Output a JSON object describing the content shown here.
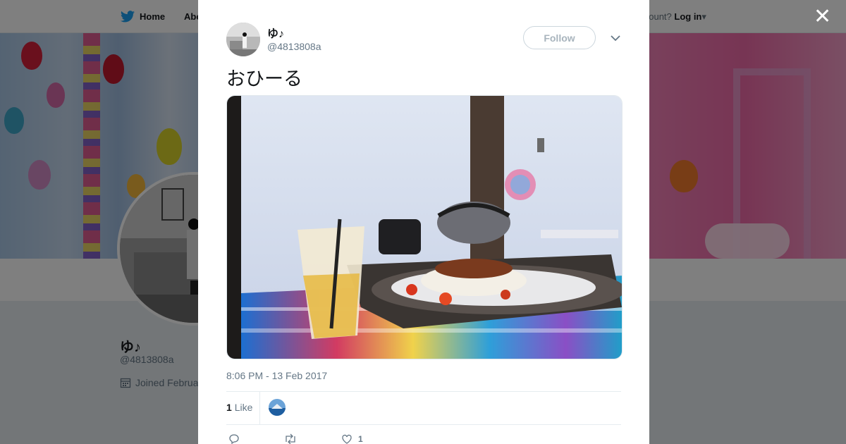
{
  "topnav": {
    "home_label": "Home",
    "about_label": "About",
    "have_account_text": "account?",
    "login_label": "Log in"
  },
  "profile": {
    "name": "ゆ♪",
    "handle": "@4813808a",
    "joined_text": "Joined February"
  },
  "tweet": {
    "author_name": "ゆ♪",
    "author_handle": "@4813808a",
    "follow_label": "Follow",
    "text": "おひーる",
    "timestamp": "8:06 PM - 13 Feb 2017",
    "like_count": "1",
    "like_word": "Like",
    "action_like_count": "1"
  },
  "colors": {
    "twitter_blue": "#1da1f2",
    "text_primary": "#14171a",
    "text_secondary": "#657786"
  },
  "icons": [
    "twitter-bird-icon",
    "calendar-icon",
    "close-icon",
    "chevron-down-icon",
    "reply-icon",
    "retweet-icon",
    "heart-icon"
  ]
}
